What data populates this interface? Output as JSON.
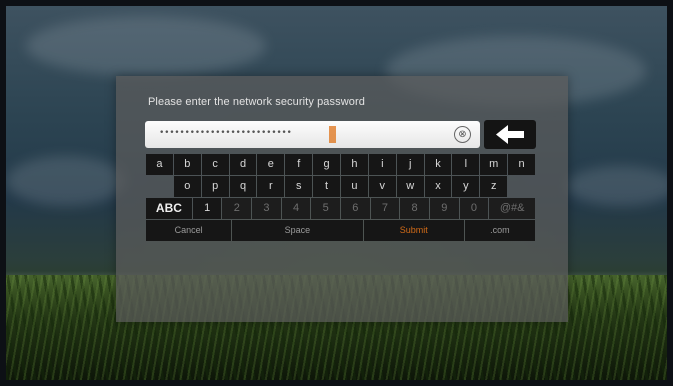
{
  "dialog": {
    "prompt": "Please enter the network security password",
    "password_mask": "••••••••••••••••••••••••••",
    "clear_icon": "⊗"
  },
  "keyboard": {
    "row1": [
      "a",
      "b",
      "c",
      "d",
      "e",
      "f",
      "g",
      "h",
      "i",
      "j",
      "k",
      "l",
      "m",
      "n"
    ],
    "row2": [
      "o",
      "p",
      "q",
      "r",
      "s",
      "t",
      "u",
      "v",
      "w",
      "x",
      "y",
      "z"
    ],
    "row3": [
      "ABC",
      "1",
      "2",
      "3",
      "4",
      "5",
      "6",
      "7",
      "8",
      "9",
      "0",
      "@#&"
    ],
    "row4": {
      "cancel": "Cancel",
      "space": "Space",
      "submit": "Submit",
      "com": ".com"
    }
  },
  "icons": {
    "backspace": "backspace-arrow-icon",
    "clear": "clear-circle-icon"
  },
  "colors": {
    "accent": "#d06a18",
    "key_bg": "#161616",
    "dialog_bg": "#5c5c5c"
  }
}
